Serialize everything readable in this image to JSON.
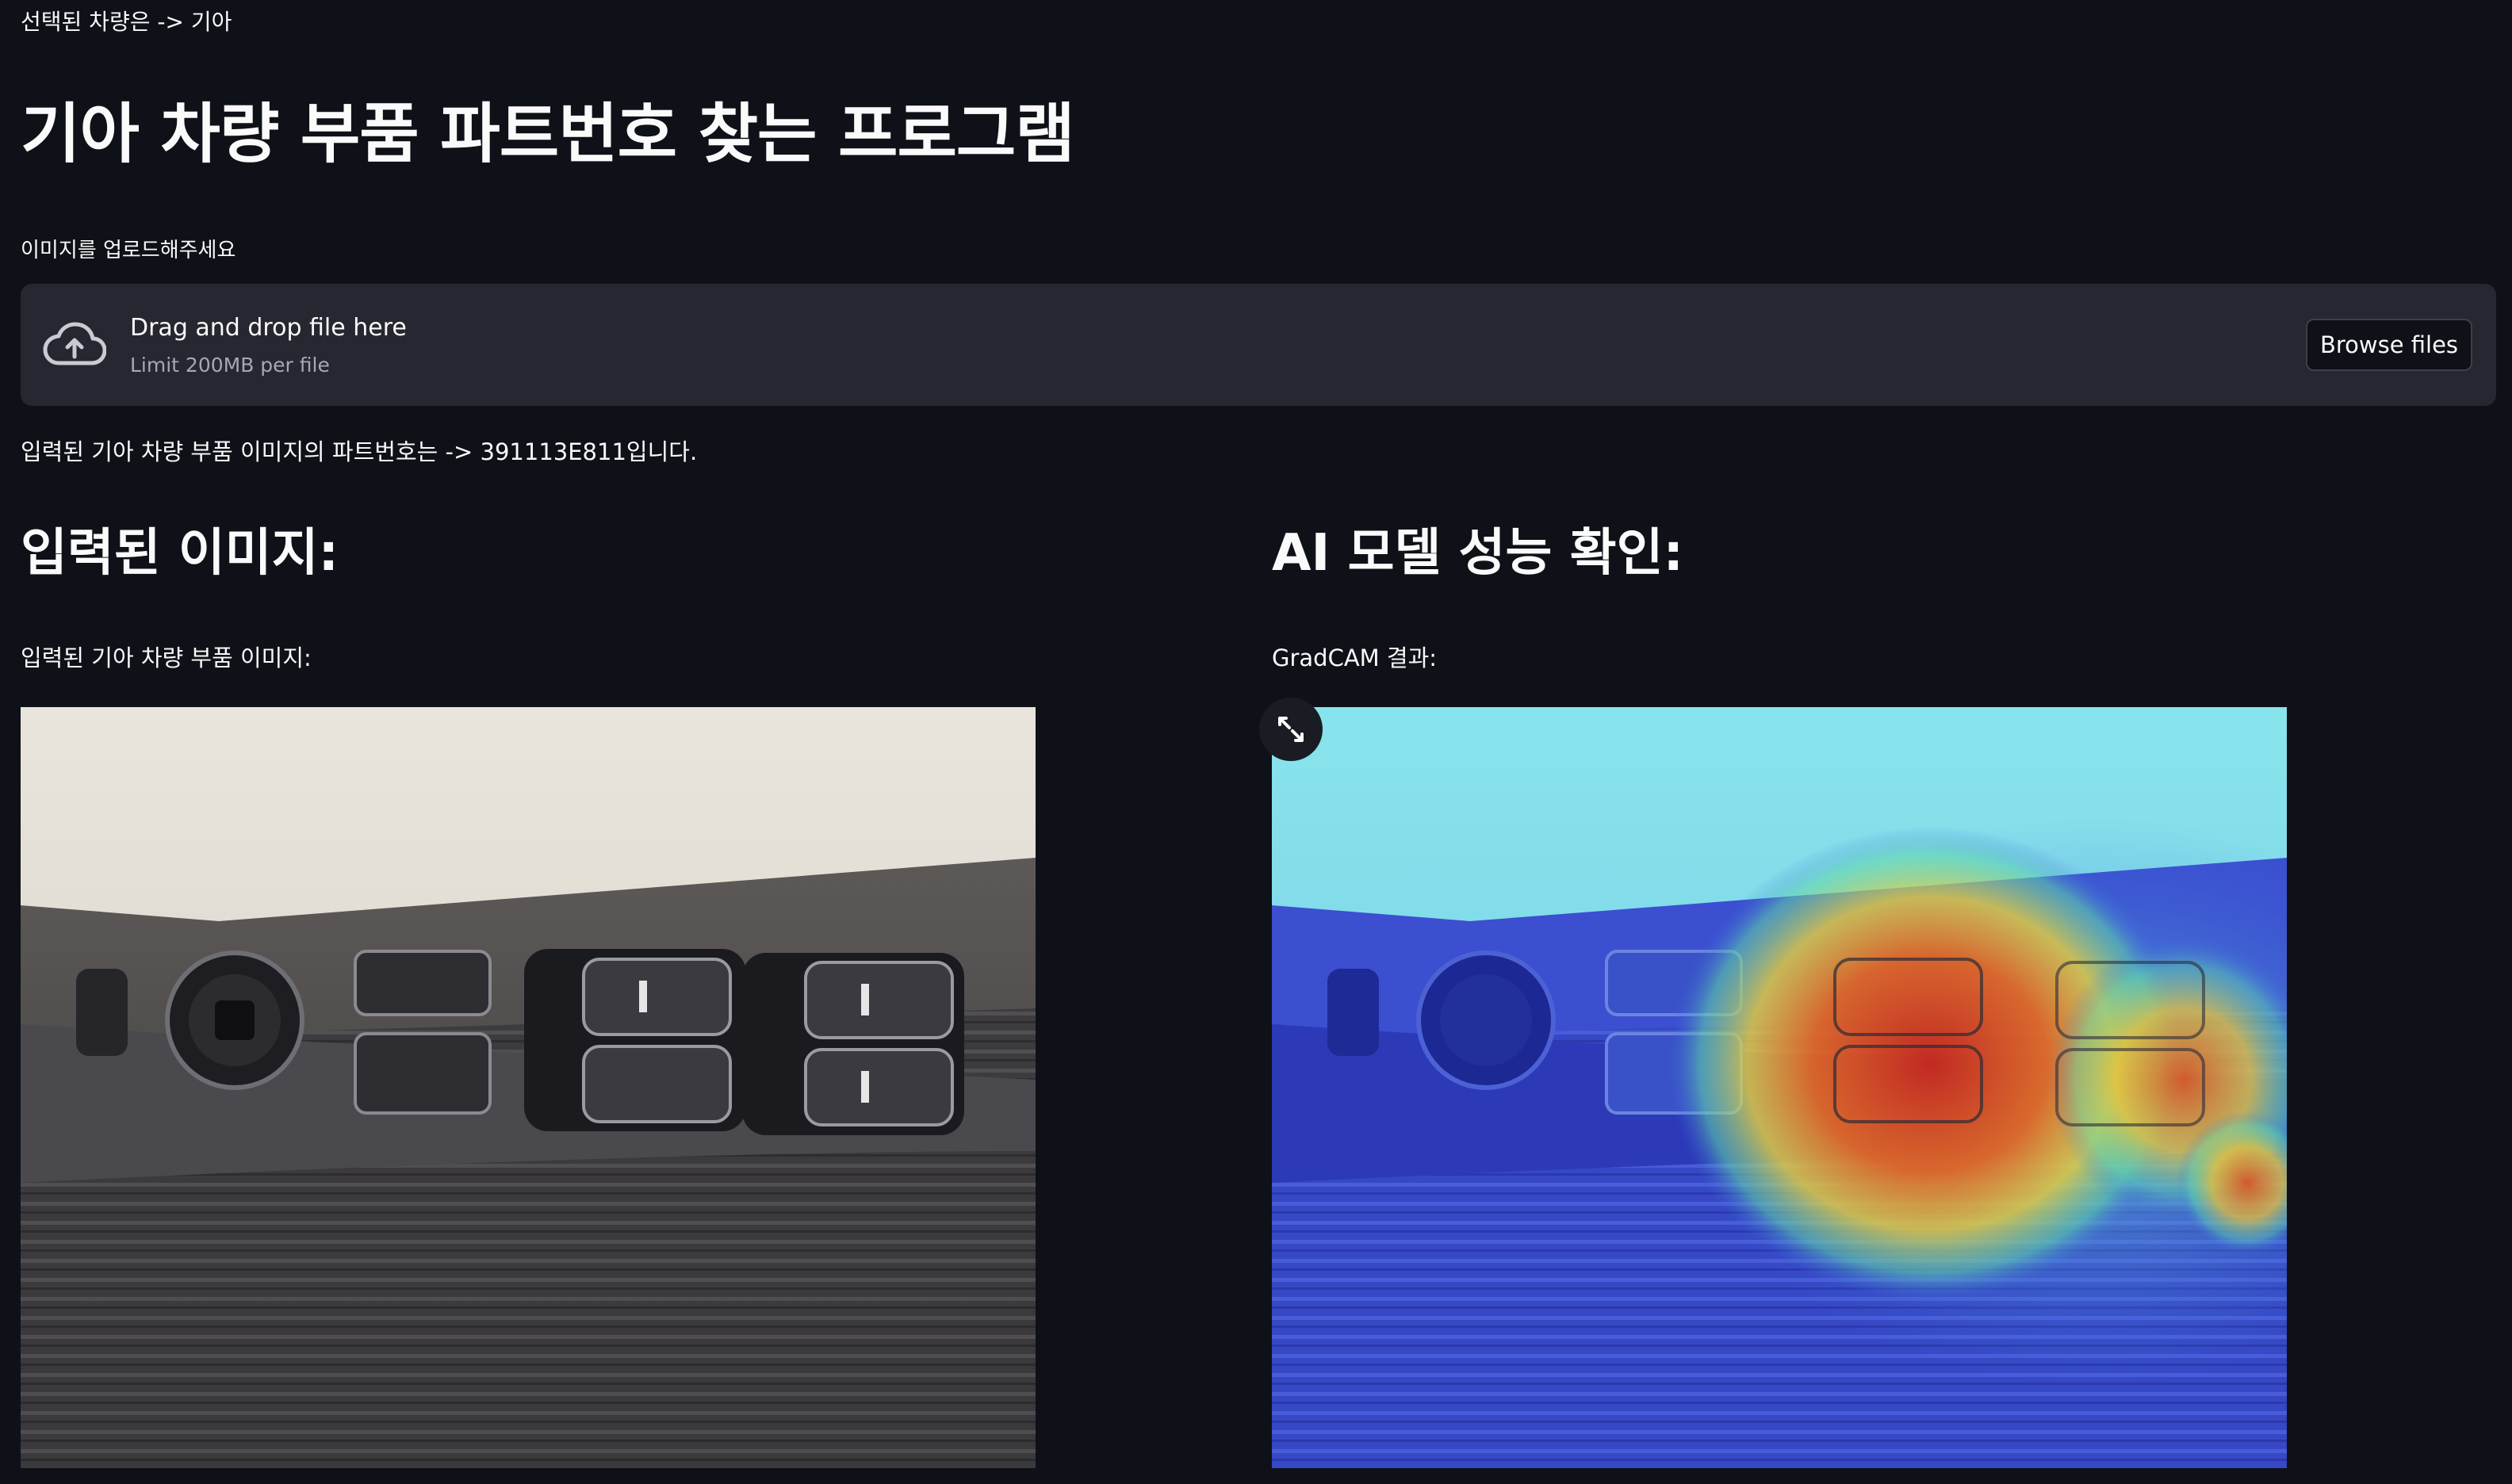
{
  "header": {
    "selected_text": "선택된 차량은 -> 기아",
    "title": "기아 차량 부품 파트번호 찾는 프로그램"
  },
  "uploader": {
    "label": "이미지를 업로드해주세요",
    "drop_text": "Drag and drop file here",
    "limit_text": "Limit 200MB per file",
    "browse_label": "Browse files"
  },
  "result": {
    "text": "입력된 기아 차량 부품 이미지의 파트번호는 -> 391113E811입니다."
  },
  "left_column": {
    "heading": "입력된 이미지:",
    "caption": "입력된 기아 차량 부품 이미지:"
  },
  "right_column": {
    "heading": "AI 모델 성능 확인:",
    "caption": "GradCAM 결과:"
  },
  "icons": {
    "upload": "cloud-upload-icon",
    "expand": "expand-icon"
  },
  "colors": {
    "background": "#0e1117",
    "panel": "#262730",
    "text": "#fafafa",
    "muted": "#a3a8b8"
  }
}
